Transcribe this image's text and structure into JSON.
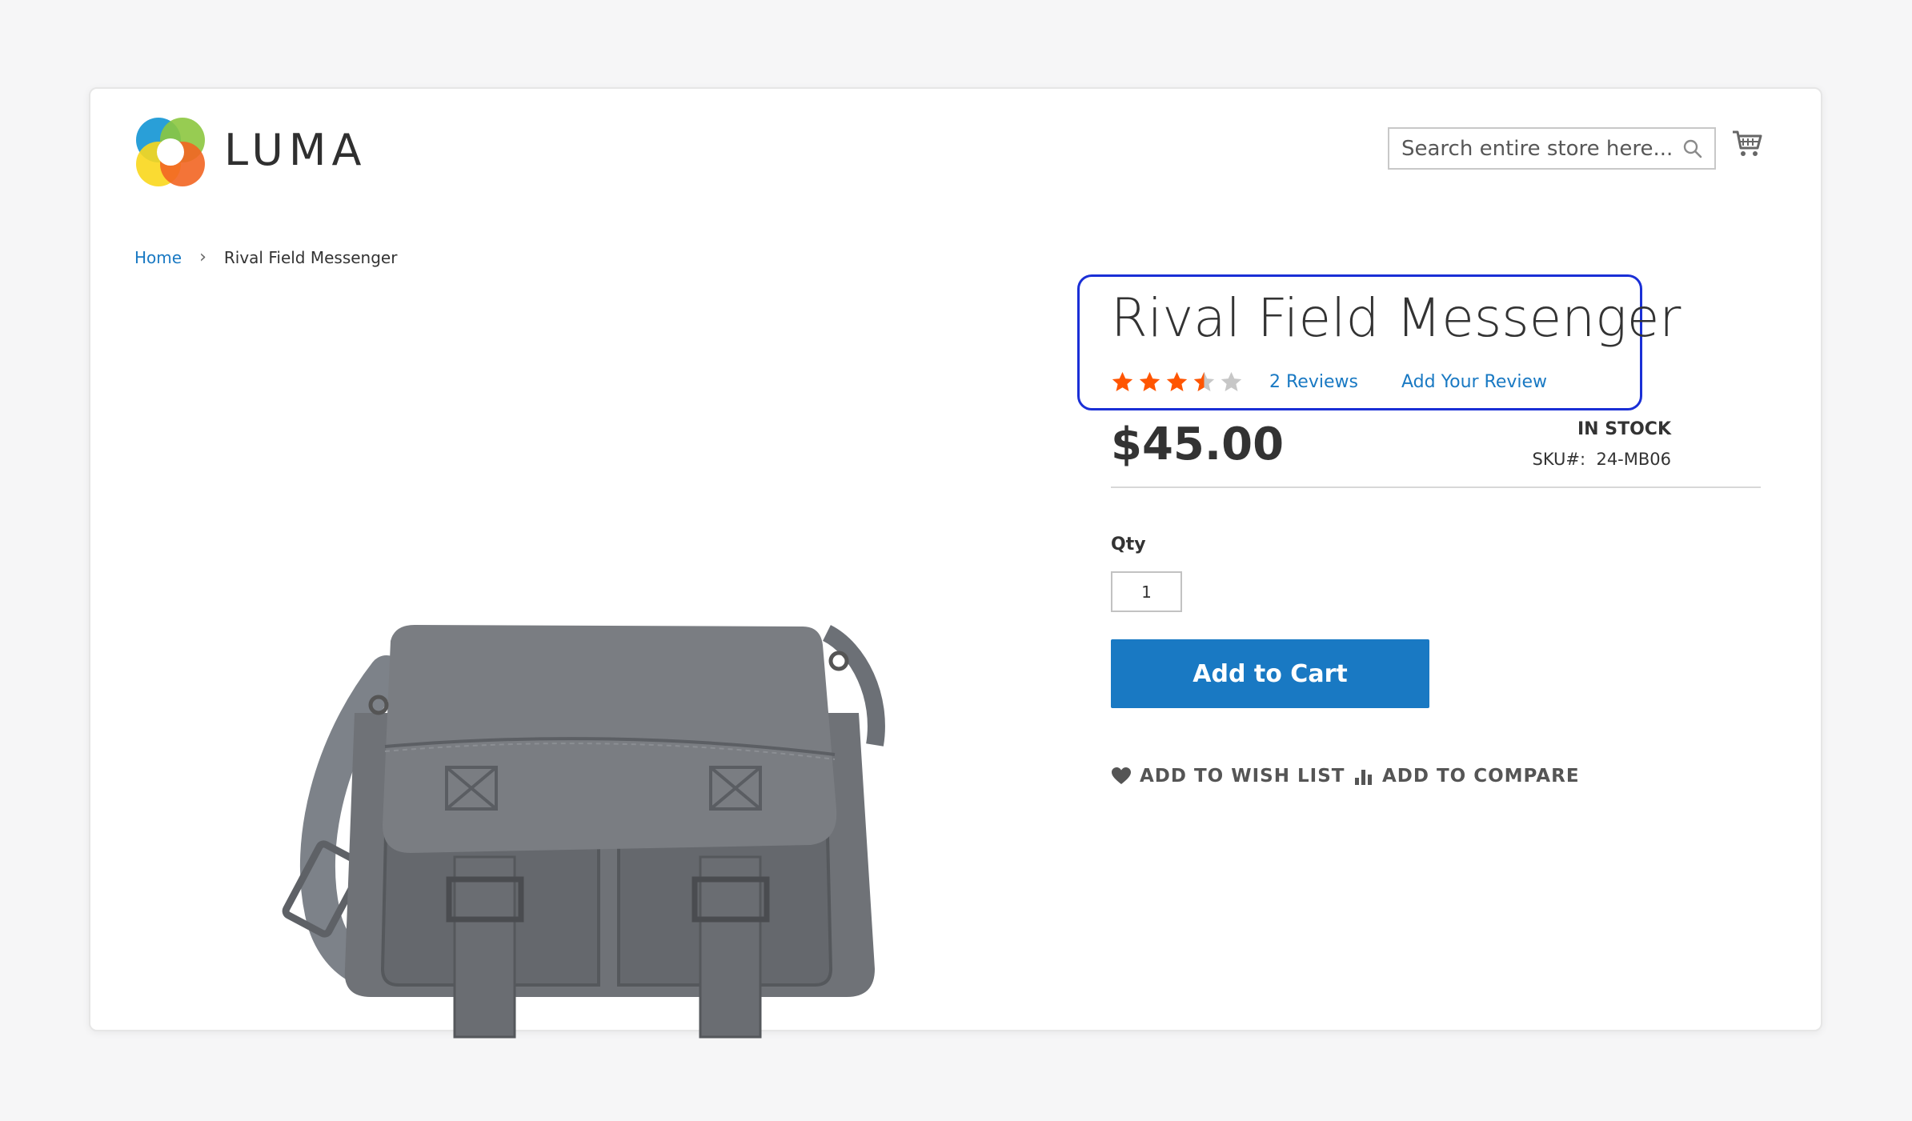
{
  "brand": {
    "name": "LUMA"
  },
  "header": {
    "search": {
      "placeholder": "Search entire store here...",
      "value": ""
    },
    "icons": {
      "search": "search-icon",
      "cart": "cart-icon"
    }
  },
  "breadcrumb": {
    "items": [
      {
        "label": "Home"
      },
      {
        "label": "Rival Field Messenger"
      }
    ],
    "separator": "›"
  },
  "product": {
    "name": "Rival Field Messenger",
    "rating": {
      "stars": 3.5,
      "max": 5
    },
    "reviews_label": "2  Reviews",
    "add_review_label": "Add Your Review",
    "price": "$45.00",
    "stock_status": "IN STOCK",
    "sku_label": "SKU#:",
    "sku_value": "24-MB06",
    "qty_label": "Qty",
    "qty_value": "1",
    "add_to_cart_label": "Add to Cart",
    "wishlist_label": "ADD TO WISH LIST",
    "compare_label": "ADD TO COMPARE"
  },
  "colors": {
    "accent": "#1979c3",
    "rating_star": "#ff5501",
    "empty_star": "#c7c7c7",
    "highlight_border": "#1a2fd6"
  }
}
